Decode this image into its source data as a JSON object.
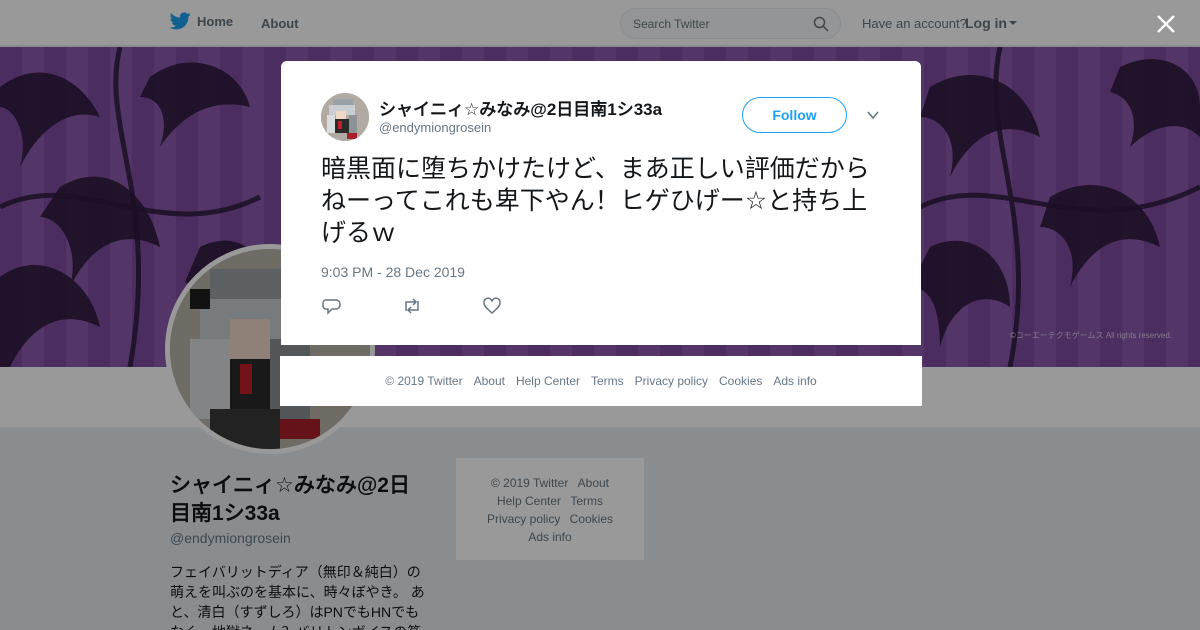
{
  "nav": {
    "home_label": "Home",
    "about_label": "About",
    "search_placeholder": "Search Twitter",
    "account_prompt": "Have an account?",
    "login_label": "Log in"
  },
  "banner": {
    "copyright": "©コーエーテクモゲームス All rights reserved."
  },
  "profile": {
    "name": "シャイニィ☆みなみ@2日目南1シ33a",
    "handle": "@endymiongrosein",
    "bio": "フェイバリットディア（無印＆純白）の萌えを叫ぶのを基本に、時々ぼやき。 あと、清白（すずしろ）はPNでもHNでもなく、地獄ネーム？バリトンボイスの篆"
  },
  "side_footer": {
    "items": [
      "© 2019 Twitter",
      "About",
      "Help Center",
      "Terms",
      "Privacy policy",
      "Cookies",
      "Ads info"
    ]
  },
  "tweet": {
    "author_name": "シャイニィ☆みなみ@2日目南1シ33a",
    "author_handle": "@endymiongrosein",
    "follow_label": "Follow",
    "text": "暗黒面に堕ちかけたけど、まあ正しい評価だからねーってこれも卑下やん！ヒゲひげー☆と持ち上げるｗ",
    "timestamp": "9:03 PM - 28 Dec 2019"
  },
  "modal_footer": {
    "items": [
      "© 2019 Twitter",
      "About",
      "Help Center",
      "Terms",
      "Privacy policy",
      "Cookies",
      "Ads info"
    ]
  },
  "colors": {
    "brand": "#1da1f2",
    "banner": "#7f4ba0"
  },
  "icons": [
    "twitter-bird-icon",
    "search-icon",
    "close-icon",
    "chevron-down-icon",
    "reply-icon",
    "retweet-icon",
    "like-icon"
  ]
}
